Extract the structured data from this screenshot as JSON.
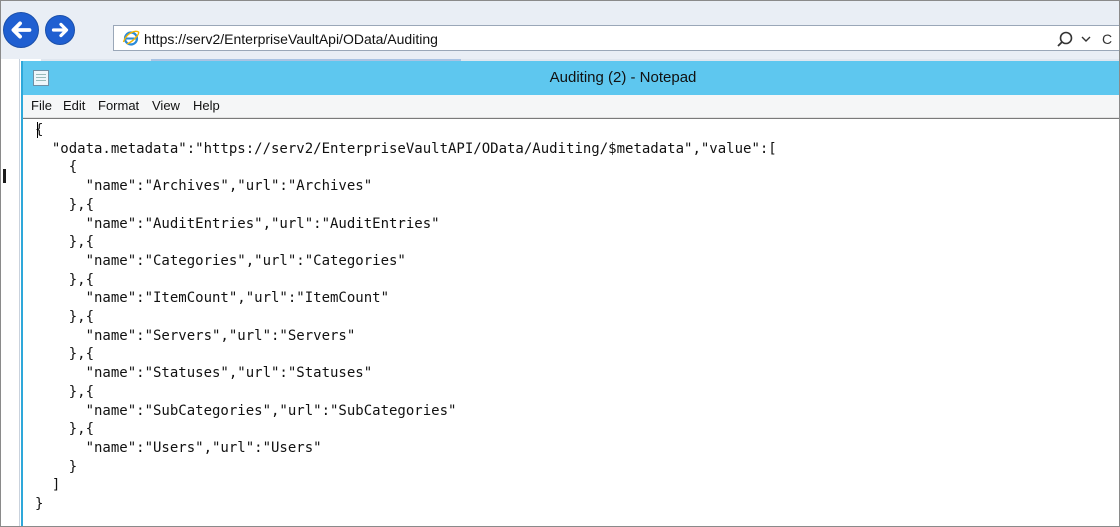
{
  "browser": {
    "url": "https://serv2/EnterpriseVaultApi/OData/Auditing",
    "back_icon": "back-arrow-icon",
    "forward_icon": "forward-arrow-icon",
    "page_icon": "ie-icon",
    "search_icon": "search-icon",
    "search_dropdown_icon": "chevron-down-icon",
    "partial_button_text": "C"
  },
  "notepad": {
    "title": "Auditing (2) - Notepad",
    "menu": [
      "File",
      "Edit",
      "Format",
      "View",
      "Help"
    ],
    "lines": [
      "{",
      "  \"odata.metadata\":\"https://serv2/EnterpriseVaultAPI/OData/Auditing/$metadata\",\"value\":[",
      "    {",
      "      \"name\":\"Archives\",\"url\":\"Archives\"",
      "    },{",
      "      \"name\":\"AuditEntries\",\"url\":\"AuditEntries\"",
      "    },{",
      "      \"name\":\"Categories\",\"url\":\"Categories\"",
      "    },{",
      "      \"name\":\"ItemCount\",\"url\":\"ItemCount\"",
      "    },{",
      "      \"name\":\"Servers\",\"url\":\"Servers\"",
      "    },{",
      "      \"name\":\"Statuses\",\"url\":\"Statuses\"",
      "    },{",
      "      \"name\":\"SubCategories\",\"url\":\"SubCategories\"",
      "    },{",
      "      \"name\":\"Users\",\"url\":\"Users\"",
      "    }",
      "  ]",
      "}"
    ]
  }
}
